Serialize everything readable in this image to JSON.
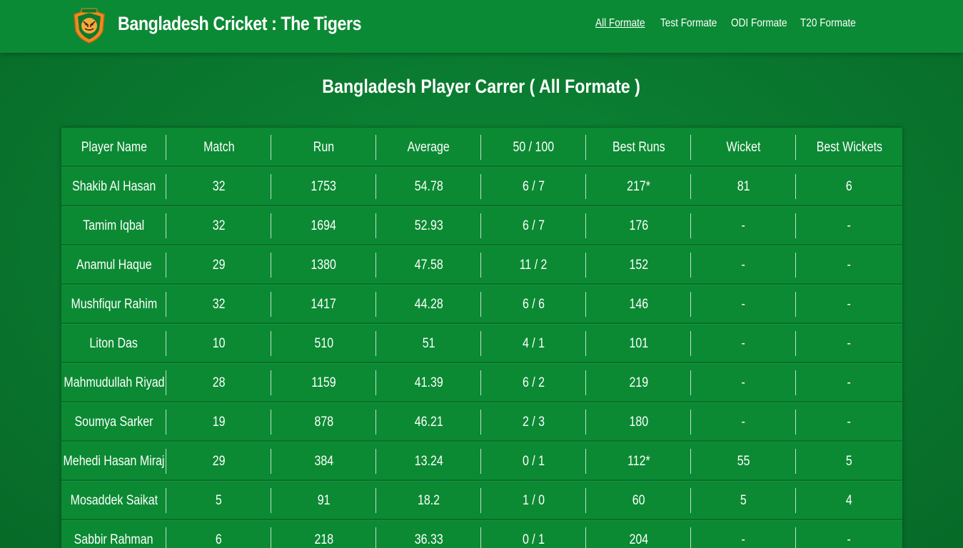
{
  "header": {
    "brand": "Bangladesh Cricket : The Tigers",
    "nav": [
      {
        "label": "All Formate",
        "active": true
      },
      {
        "label": "Test Formate",
        "active": false
      },
      {
        "label": "ODI Formate",
        "active": false
      },
      {
        "label": "T20 Formate",
        "active": false
      }
    ]
  },
  "main": {
    "title": "Bangladesh Player Carrer ( All Formate )"
  },
  "table": {
    "headers": [
      "Player Name",
      "Match",
      "Run",
      "Average",
      "50 / 100",
      "Best Runs",
      "Wicket",
      "Best Wickets"
    ],
    "rows": [
      [
        "Shakib Al Hasan",
        "32",
        "1753",
        "54.78",
        "6 / 7",
        "217*",
        "81",
        "6"
      ],
      [
        "Tamim Iqbal",
        "32",
        "1694",
        "52.93",
        "6 / 7",
        "176",
        "-",
        "-"
      ],
      [
        "Anamul Haque",
        "29",
        "1380",
        "47.58",
        "11 / 2",
        "152",
        "-",
        "-"
      ],
      [
        "Mushfiqur Rahim",
        "32",
        "1417",
        "44.28",
        "6 / 6",
        "146",
        "-",
        "-"
      ],
      [
        "Liton Das",
        "10",
        "510",
        "51",
        "4 / 1",
        "101",
        "-",
        "-"
      ],
      [
        "Mahmudullah Riyad",
        "28",
        "1159",
        "41.39",
        "6 / 2",
        "219",
        "-",
        "-"
      ],
      [
        "Soumya Sarker",
        "19",
        "878",
        "46.21",
        "2 / 3",
        "180",
        "-",
        "-"
      ],
      [
        "Mehedi Hasan Miraj",
        "29",
        "384",
        "13.24",
        "0 / 1",
        "112*",
        "55",
        "5"
      ],
      [
        "Mosaddek Saikat",
        "5",
        "91",
        "18.2",
        "1 / 0",
        "60",
        "5",
        "4"
      ],
      [
        "Sabbir Rahman",
        "6",
        "218",
        "36.33",
        "0 / 1",
        "204",
        "-",
        "-"
      ]
    ]
  },
  "colors": {
    "background": "#0a7a30",
    "navbar": "#0a8a34",
    "table": "#0b8a33",
    "logo_orange": "#f08a1c",
    "logo_green": "#0b7a2e"
  },
  "icons": {
    "logo": "tiger-emblem-icon"
  }
}
